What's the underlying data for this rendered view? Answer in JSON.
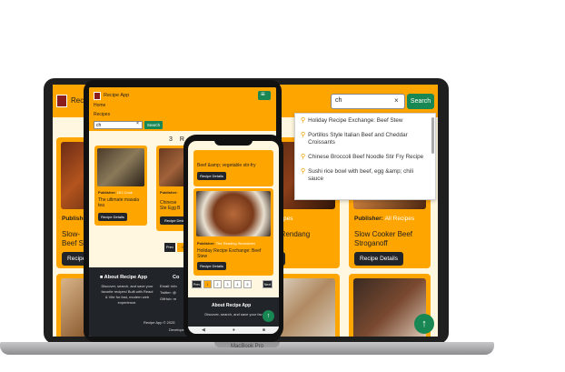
{
  "laptop": {
    "brand": "Rec",
    "model_label": "MacBook Pro",
    "search": {
      "value": "ch",
      "clear": "×",
      "button": "Search"
    },
    "suggestions": [
      "Holiday Recipe Exchange: Beef Stew",
      "Portillos Style Italian Beef and Cheddar Croissants",
      "Chinese Broccoli Beef Noodle Stir Fry Recipe",
      "Sushi rice bowl with beef, egg &amp; chili sauce"
    ],
    "cards": [
      {
        "publisher_label": "Publisher:",
        "publisher": "",
        "title": "Slow-",
        "title2": "Beef S",
        "button": "Recipe Details"
      },
      {
        "publisher_label": "",
        "publisher": "All Recipes",
        "title": "Beef Rendang",
        "title2": "",
        "button": "etails"
      },
      {
        "publisher_label": "Publisher:",
        "publisher": "All Recipes",
        "title": "Slow Cooker Beef",
        "title2": "Stroganoff",
        "button": "Recipe Details"
      }
    ],
    "fab": "↑"
  },
  "tablet": {
    "brand": "Recipe App",
    "nav_home": "Home",
    "nav_recipes": "Recipes",
    "search_value": "ch",
    "search_clear": "×",
    "search_button": "Search",
    "section_header": "3 R",
    "cards": [
      {
        "publisher_label": "Publisher:",
        "publisher": "101 Cook",
        "title": "The ultimate masala",
        "title2": "tea",
        "button": "Recipe Details"
      },
      {
        "publisher_label": "Publisher:",
        "publisher": "",
        "title": "Chinese",
        "title2": "Ste Egg B",
        "button": "Recipe Deta"
      }
    ],
    "pagination": [
      "Prev",
      "1"
    ],
    "footer": {
      "about_title": "About Recipe App",
      "about_text": "Discover, search, and save your favorite recipes! Built with React & Vite for fast, modern web experience.",
      "contact_title": "Co",
      "contact_lines": [
        "Email: info",
        "Twitter: @",
        "GitHub: re"
      ],
      "copyright": "Recipe App © 2025",
      "developer": "Developed"
    }
  },
  "phone": {
    "card1_title": "Beef &amp; vegetable stir-fry",
    "card1_button": "Recipe Details",
    "card2_publisher_label": "Publisher:",
    "card2_publisher": "The Reading Worksheet",
    "card2_title": "Holiday Recipe Exchange: Beef Stew",
    "card2_button": "Recipe Details",
    "pagination": [
      "Prev",
      "1",
      "2",
      "3",
      "4",
      "5",
      "Next"
    ],
    "footer_about_title": "About Recipe App",
    "footer_about_text": "Discover, search, and save your fav",
    "fab": "↑",
    "nav": [
      "◀",
      "●",
      "■"
    ]
  }
}
